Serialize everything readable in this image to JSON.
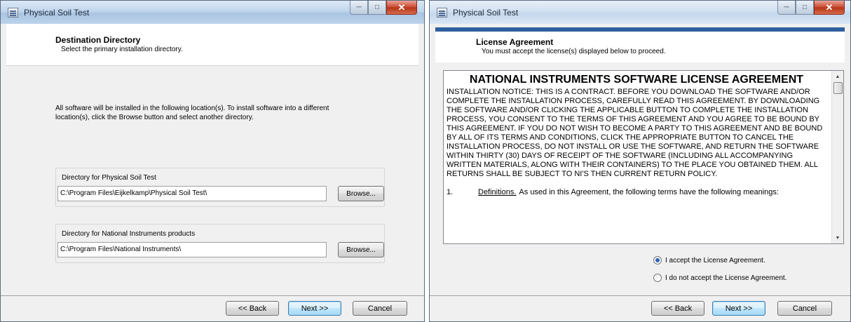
{
  "window1": {
    "title": "Physical Soil Test",
    "header_title": "Destination Directory",
    "header_subtitle": "Select the primary installation directory.",
    "instructions": "All software will be installed in the following location(s). To install software into a different location(s), click the Browse button and select another directory.",
    "dir1_label": "Directory for Physical Soil Test",
    "dir1_value": "C:\\Program Files\\Eijkelkamp\\Physical Soil Test\\",
    "dir2_label": "Directory for National Instruments products",
    "dir2_value": "C:\\Program Files\\National Instruments\\",
    "browse_label": "Browse...",
    "back_label": "<< Back",
    "next_label": "Next >>",
    "cancel_label": "Cancel"
  },
  "window2": {
    "title": "Physical Soil Test",
    "header_title": "License Agreement",
    "header_subtitle": "You must accept the license(s) displayed below to proceed.",
    "license_heading": "NATIONAL INSTRUMENTS SOFTWARE LICENSE AGREEMENT",
    "license_body": "INSTALLATION NOTICE: THIS IS A CONTRACT. BEFORE YOU DOWNLOAD THE SOFTWARE AND/OR COMPLETE THE INSTALLATION PROCESS, CAREFULLY READ THIS AGREEMENT. BY DOWNLOADING THE SOFTWARE AND/OR CLICKING THE APPLICABLE BUTTON TO COMPLETE THE INSTALLATION PROCESS, YOU CONSENT TO THE TERMS OF THIS AGREEMENT AND YOU AGREE TO BE BOUND BY THIS AGREEMENT. IF YOU DO NOT WISH TO BECOME A PARTY TO THIS AGREEMENT AND BE BOUND BY ALL OF ITS TERMS AND CONDITIONS, CLICK THE APPROPRIATE BUTTON TO CANCEL THE INSTALLATION PROCESS, DO NOT INSTALL OR USE THE SOFTWARE, AND RETURN THE SOFTWARE WITHIN THIRTY (30) DAYS OF RECEIPT OF THE SOFTWARE (INCLUDING ALL ACCOMPANYING WRITTEN MATERIALS, ALONG WITH THEIR CONTAINERS) TO THE PLACE YOU OBTAINED THEM. ALL RETURNS SHALL BE SUBJECT TO NI'S THEN CURRENT RETURN POLICY.",
    "def_number": "1.",
    "def_term": "Definitions.",
    "def_text": "As used in this Agreement, the following terms have the following meanings:",
    "accept_label": "I accept the License Agreement.",
    "decline_label": "I do not accept the License Agreement.",
    "accept_selected": true,
    "back_label": "<< Back",
    "next_label": "Next >>",
    "cancel_label": "Cancel"
  },
  "icons": [
    "app-icon",
    "minimize-icon",
    "maximize-icon",
    "close-icon",
    "scroll-up-arrow-icon",
    "scroll-down-arrow-icon"
  ],
  "colors": {
    "accent_bar": "#2f5f9e",
    "close_button": "#c8482e",
    "default_button": "#3c7fb1"
  }
}
